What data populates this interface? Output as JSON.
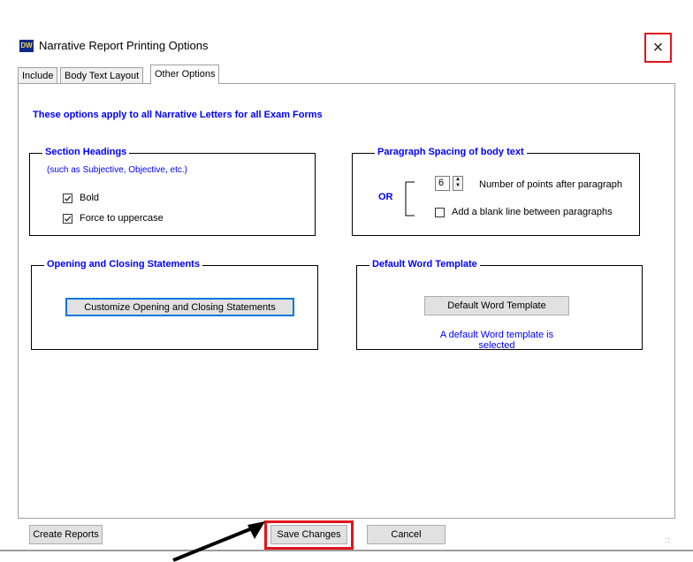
{
  "window": {
    "app_icon_text": "DW",
    "title": "Narrative Report Printing Options",
    "close_glyph": "×"
  },
  "tabs": [
    {
      "label": "Include"
    },
    {
      "label": "Body Text Layout"
    },
    {
      "label": "Other Options"
    }
  ],
  "active_tab": "Other Options",
  "apply_note": "These options apply to all Narrative Letters for all Exam Forms",
  "section_headings": {
    "legend": "Section Headings",
    "subtitle": "(such as Subjective, Objective, etc.)",
    "bold": {
      "label": "Bold",
      "checked": true
    },
    "uppercase": {
      "label": "Force to uppercase",
      "checked": true
    }
  },
  "paragraph_spacing": {
    "legend": "Paragraph Spacing of body text",
    "or_label": "OR",
    "points_value": "6",
    "points_label": "Number of points after paragraph",
    "blank_line": {
      "label": "Add a blank line between paragraphs",
      "checked": false
    }
  },
  "opening_closing": {
    "legend": "Opening and Closing Statements",
    "button_label": "Customize Opening and Closing Statements"
  },
  "word_template": {
    "legend": "Default Word Template",
    "button_label": "Default Word Template",
    "status": "A default Word template is selected"
  },
  "footer": {
    "create_reports": "Create Reports",
    "save_changes": "Save Changes",
    "cancel": "Cancel"
  },
  "colors": {
    "accent_blue": "#0000ff",
    "highlight_red": "#e0141c"
  }
}
